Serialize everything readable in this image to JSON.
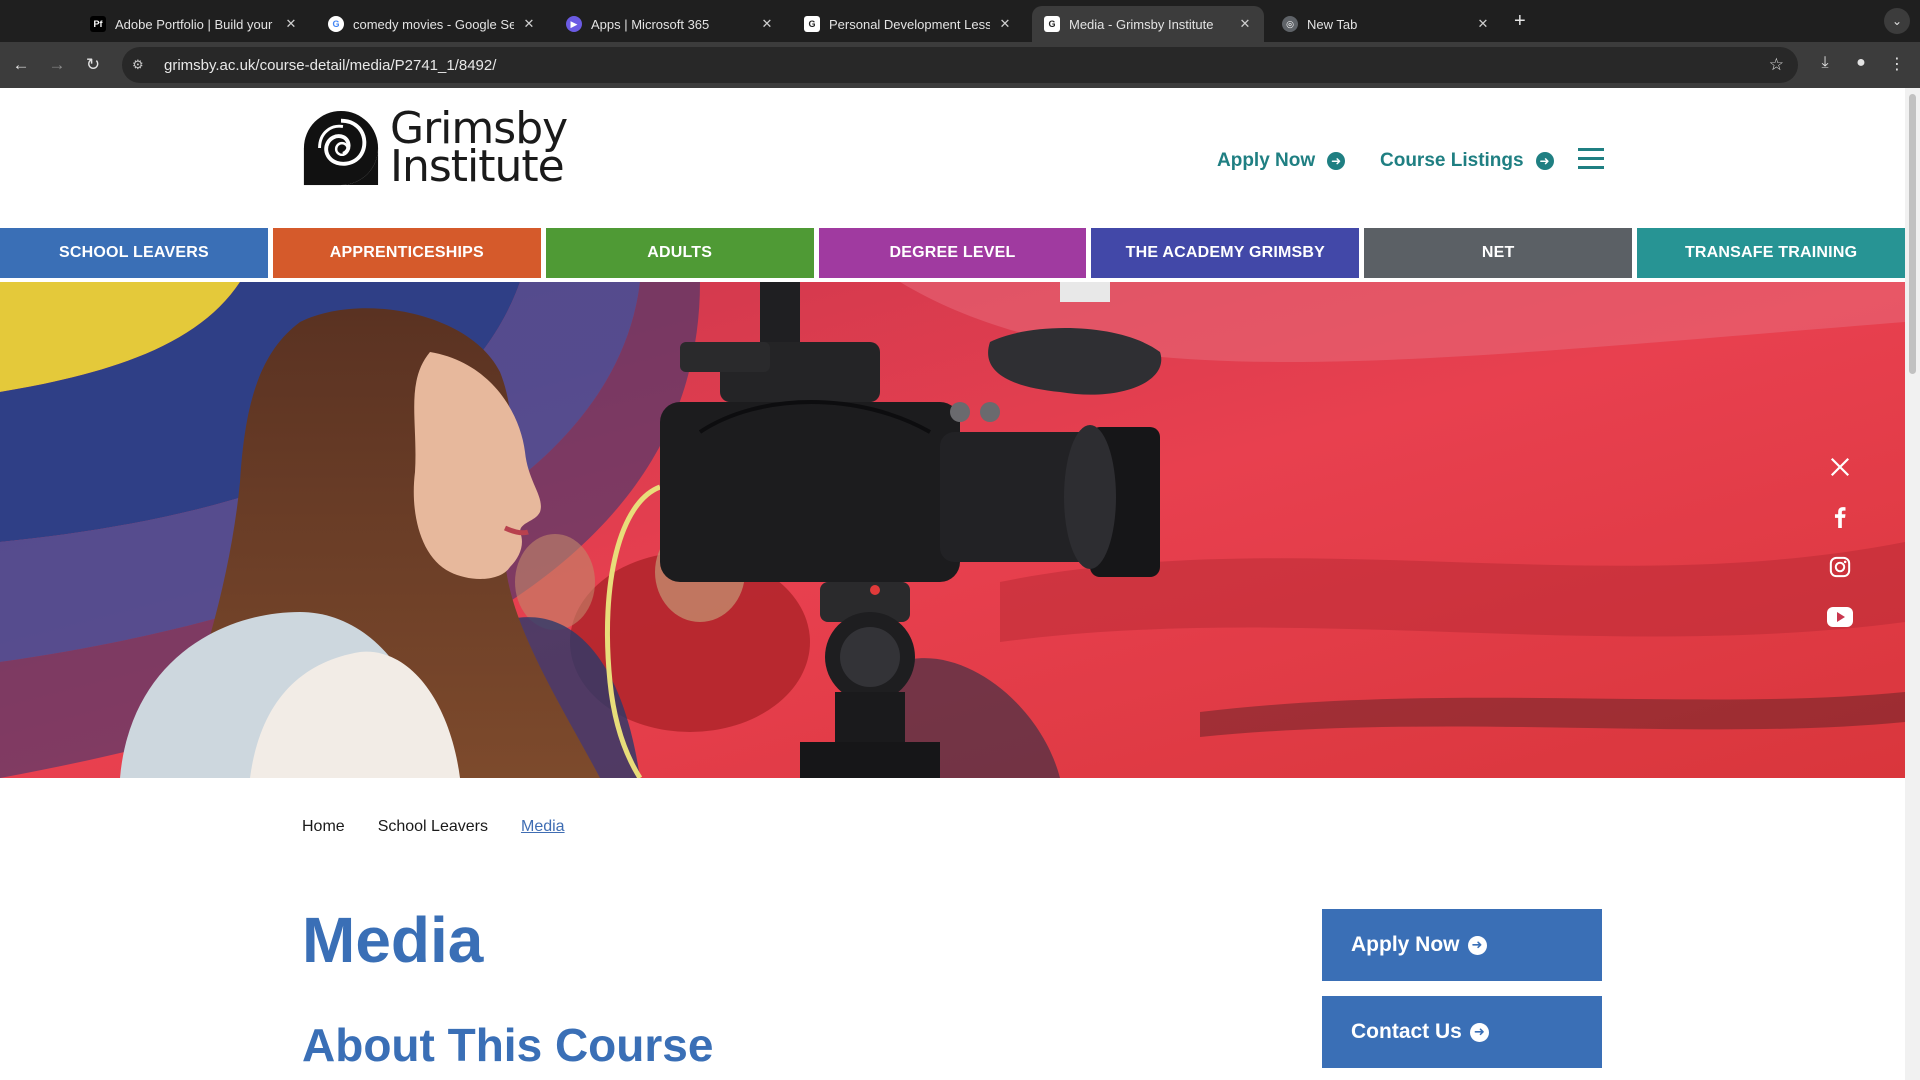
{
  "browser": {
    "tabs": [
      {
        "title": "Adobe Portfolio | Build your o",
        "favicon": "Pf",
        "favicon_color": "#111"
      },
      {
        "title": "comedy movies - Google Sea",
        "favicon": "G",
        "favicon_color": "#ffffff"
      },
      {
        "title": "Apps | Microsoft 365",
        "favicon": "▶",
        "favicon_color": "#6b5be3"
      },
      {
        "title": "Personal Development Lesso",
        "favicon": "G",
        "favicon_color": "#ffffff"
      },
      {
        "title": "Media - Grimsby Institute",
        "favicon": "G",
        "favicon_color": "#ffffff",
        "active": true
      },
      {
        "title": "New Tab",
        "favicon": "◎",
        "favicon_color": "#9aa0a6"
      }
    ],
    "url": "grimsby.ac.uk/course-detail/media/P2741_1/8492/"
  },
  "header": {
    "logo_line1": "Grimsby",
    "logo_line2": "Institute",
    "apply_now": "Apply Now",
    "course_listings": "Course Listings",
    "accent_color": "#1f7f82"
  },
  "main_nav": [
    {
      "label": "SCHOOL LEAVERS",
      "color": "#3a6fb6"
    },
    {
      "label": "APPRENTICESHIPS",
      "color": "#d55a2b"
    },
    {
      "label": "ADULTS",
      "color": "#4f9a35"
    },
    {
      "label": "DEGREE LEVEL",
      "color": "#a03aa0"
    },
    {
      "label": "THE ACADEMY GRIMSBY",
      "color": "#4248a8"
    },
    {
      "label": "NET",
      "color": "#5b6065"
    },
    {
      "label": "TRANSAFE TRAINING",
      "color": "#279494"
    }
  ],
  "social_icons": [
    "x-icon",
    "facebook-icon",
    "instagram-icon",
    "youtube-icon"
  ],
  "breadcrumb": {
    "home": "Home",
    "section": "School Leavers",
    "current": "Media"
  },
  "content": {
    "title": "Media",
    "subtitle": "About This Course"
  },
  "sidebar": {
    "apply_now": "Apply Now",
    "contact_us": "Contact Us"
  }
}
